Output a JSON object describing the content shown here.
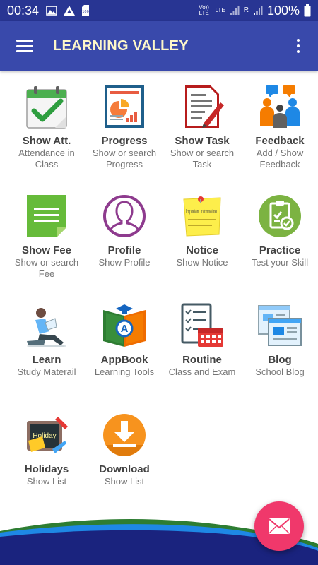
{
  "status": {
    "time": "00:34",
    "volte": "Vo)) LTE",
    "lte": "LTE",
    "signal_r": "R",
    "battery": "100%",
    "sd_label": "100"
  },
  "appbar": {
    "title": "LEARNING VALLEY",
    "menu_icon": "hamburger-menu-icon",
    "overflow_icon": "more-vert-icon"
  },
  "tiles": [
    {
      "title": "Show Att.",
      "subtitle": "Attendance in Class",
      "icon": "calendar-check-icon"
    },
    {
      "title": "Progress",
      "subtitle": "Show or search Progress",
      "icon": "report-chart-icon"
    },
    {
      "title": "Show Task",
      "subtitle": "Show or search Task",
      "icon": "document-pen-icon"
    },
    {
      "title": "Feedback",
      "subtitle": "Add / Show Feedback",
      "icon": "people-chat-icon"
    },
    {
      "title": "Show Fee",
      "subtitle": "Show or search Fee",
      "icon": "green-document-icon"
    },
    {
      "title": "Profile",
      "subtitle": "Show Profile",
      "icon": "user-circle-icon"
    },
    {
      "title": "Notice",
      "subtitle": "Show Notice",
      "icon": "sticky-note-icon",
      "note_text": "Important Information"
    },
    {
      "title": "Practice",
      "subtitle": "Test your Skill",
      "icon": "clipboard-check-icon"
    },
    {
      "title": "Learn",
      "subtitle": "Study Materail",
      "icon": "student-reading-icon"
    },
    {
      "title": "AppBook",
      "subtitle": "Learning Tools",
      "icon": "book-letter-icon",
      "book_letter": "A"
    },
    {
      "title": "Routine",
      "subtitle": "Class and Exam",
      "icon": "checklist-calendar-icon"
    },
    {
      "title": "Blog",
      "subtitle": "School Blog",
      "icon": "browser-windows-icon"
    },
    {
      "title": "Holidays",
      "subtitle": "Show List",
      "icon": "holiday-board-icon",
      "board_text": "Holiday"
    },
    {
      "title": "Download",
      "subtitle": "Show List",
      "icon": "download-circle-icon"
    }
  ],
  "fab": {
    "icon": "mail-icon"
  },
  "colors": {
    "statusbar": "#283593",
    "appbar": "#3949ab",
    "title": "#fdf7c9",
    "fab": "#f0386b"
  }
}
